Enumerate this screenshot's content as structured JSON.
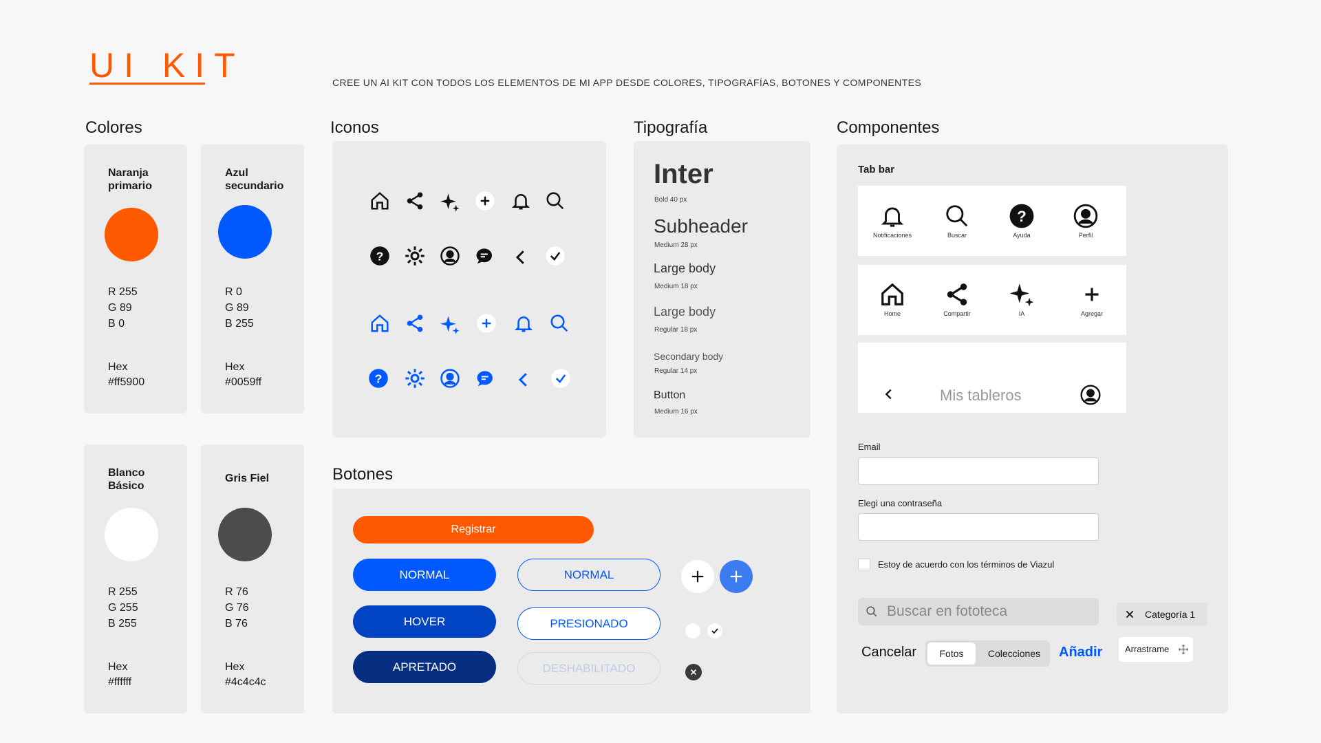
{
  "header": {
    "title": "UI KIT",
    "subtitle": "CREE UN AI KIT CON TODOS LOS ELEMENTOS DE MI APP DESDE COLORES, TIPOGRAFÍAS, BOTONES Y COMPONENTES"
  },
  "sections": {
    "colores": "Colores",
    "iconos": "Iconos",
    "tipografia": "Tipografía",
    "componentes": "Componentes",
    "botones": "Botones"
  },
  "colors": [
    {
      "name_line1": "Naranja",
      "name_line2": "primario",
      "r": "R  255",
      "g": "G  89",
      "b": "B  0",
      "hex_label": "Hex",
      "hex": "#ff5900",
      "color": "#ff5900"
    },
    {
      "name_line1": "Azul",
      "name_line2": "secundario",
      "r": "R  0",
      "g": "G  89",
      "b": "B  255",
      "hex_label": "Hex",
      "hex": "#0059ff",
      "color": "#0059ff"
    },
    {
      "name_line1": "Blanco",
      "name_line2": "Básico",
      "r": "R  255",
      "g": "G  255",
      "b": "B  255",
      "hex_label": "Hex",
      "hex": "#ffffff",
      "color": "#ffffff"
    },
    {
      "name_line1": "Gris Fiel",
      "name_line2": "",
      "r": "R  76",
      "g": "G  76",
      "b": "B  76",
      "hex_label": "Hex",
      "hex": "#4c4c4c",
      "color": "#4c4c4c"
    }
  ],
  "icons": {
    "row_names": [
      "home-icon",
      "share-icon",
      "sparkle-icon",
      "plus-circle-icon",
      "bell-icon",
      "search-icon"
    ],
    "row2_names": [
      "help-icon",
      "settings-icon",
      "profile-icon",
      "chat-icon",
      "chevron-left-icon",
      "check-icon"
    ],
    "dark": "#111111",
    "blue": "#0059ff"
  },
  "typography": [
    {
      "text": "Inter",
      "meta": "Bold 40 px"
    },
    {
      "text": "Subheader",
      "meta": "Medium 28 px"
    },
    {
      "text": "Large body",
      "meta": "Medium 18 px"
    },
    {
      "text": "Large body",
      "meta": "Regular 18 px"
    },
    {
      "text": "Secondary body",
      "meta": "Regular 14 px"
    },
    {
      "text": "Button",
      "meta": "Medium 16 px"
    }
  ],
  "buttons": {
    "registrar": "Registrar",
    "normal_filled": "NORMAL",
    "hover": "HOVER",
    "apretado": "APRETADO",
    "normal_outline": "NORMAL",
    "presionado": "PRESIONADO",
    "deshabilitado": "DESHABILITADO"
  },
  "components": {
    "tabbar_title": "Tab bar",
    "tabs1": [
      "Notificaciones",
      "Buscar",
      "Ayuda",
      "Perfil"
    ],
    "tabs2": [
      "Home",
      "Compartir",
      "IA",
      "Agregar"
    ],
    "nav_title": "Mis tableros",
    "email_label": "Email",
    "password_label": "Elegi una contraseña",
    "terms_label": "Estoy de acuerdo con los términos de Viazul",
    "search_placeholder": "Buscar en fototeca",
    "chip_label": "Categoría 1",
    "cancel": "Cancelar",
    "seg_fotos": "Fotos",
    "seg_colecciones": "Colecciones",
    "add": "Añadir",
    "drag": "Arrastrame"
  }
}
